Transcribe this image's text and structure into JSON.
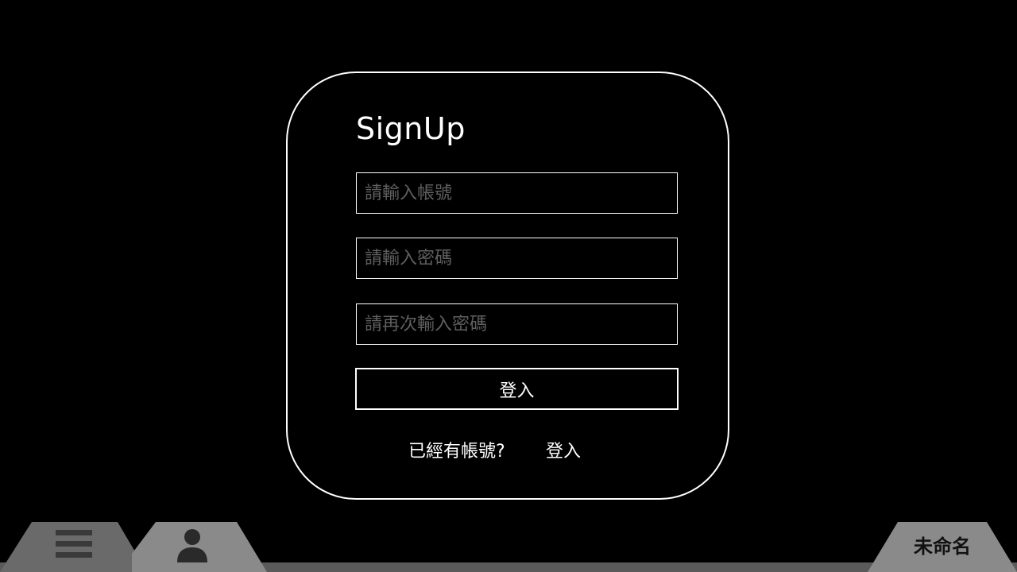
{
  "form": {
    "title": "SignUp",
    "account_placeholder": "請輸入帳號",
    "password_placeholder": "請輸入密碼",
    "confirm_placeholder": "請再次輸入密碼",
    "submit_label": "登入",
    "have_account_text": "已經有帳號?",
    "login_link_label": "登入"
  },
  "dock": {
    "document_name": "未命名",
    "menu_icon": "hamburger-menu-icon",
    "user_icon": "user-icon"
  },
  "colors": {
    "background": "#000000",
    "foreground": "#ffffff",
    "placeholder": "#5f5f5f",
    "dock_dark": "#6a6a6a",
    "dock_light": "#8a8a8a"
  }
}
